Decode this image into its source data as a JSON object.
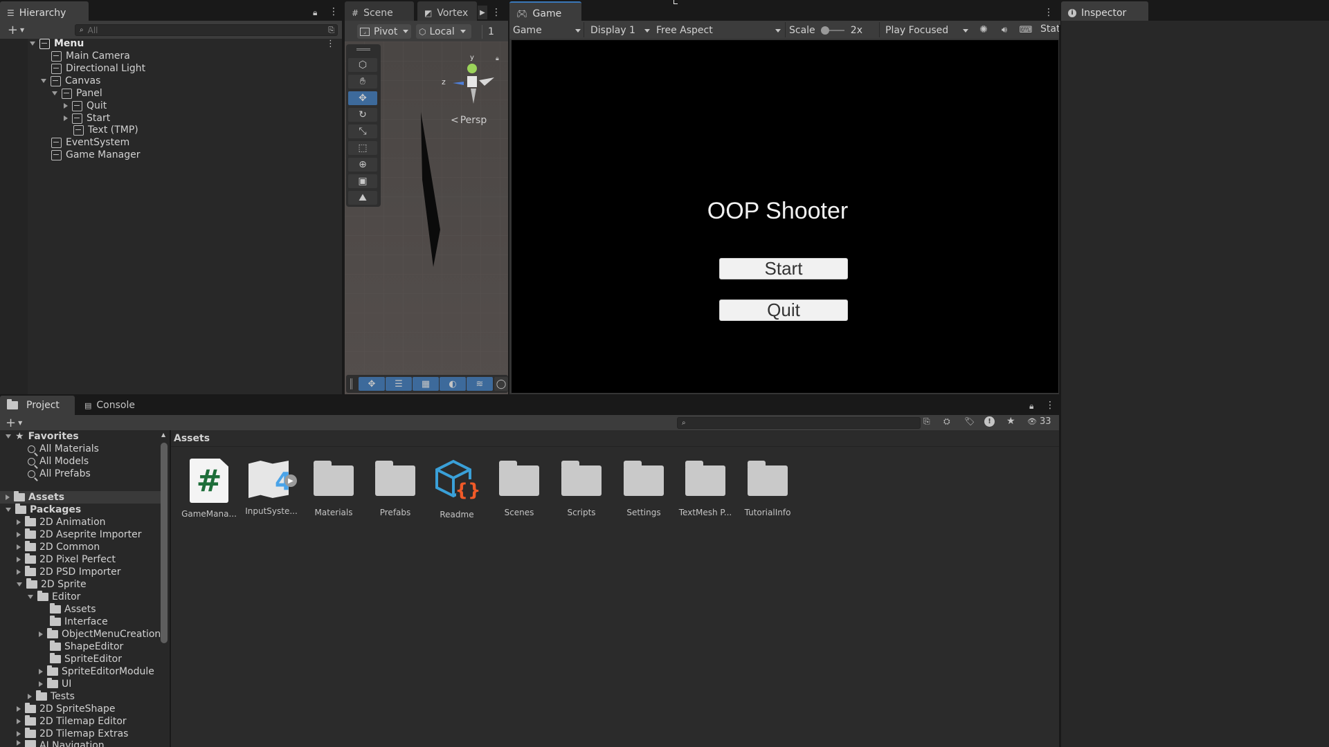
{
  "hierarchy": {
    "tab_label": "Hierarchy",
    "search_placeholder": "All",
    "items": [
      {
        "label": "Menu"
      },
      {
        "label": "Main Camera"
      },
      {
        "label": "Directional Light"
      },
      {
        "label": "Canvas"
      },
      {
        "label": "Panel"
      },
      {
        "label": "Quit"
      },
      {
        "label": "Start"
      },
      {
        "label": "Text (TMP)"
      },
      {
        "label": "EventSystem"
      },
      {
        "label": "Game Manager"
      }
    ]
  },
  "scene": {
    "tab_scene": "Scene",
    "tab_vortex": "Vortex",
    "pivot_label": "Pivot",
    "local_label": "Local",
    "snap_value": "1",
    "gizmo_y": "y",
    "gizmo_z": "z",
    "persp_label": "Persp"
  },
  "game": {
    "tab_label": "Game",
    "mode_label": "Game",
    "display_label": "Display 1",
    "aspect_label": "Free Aspect",
    "scale_label": "Scale",
    "scale_value": "2x",
    "play_focus_label": "Play Focused",
    "stats_label": "Stat",
    "view_title": "OOP Shooter",
    "start_button": "Start",
    "quit_button": "Quit"
  },
  "inspector": {
    "tab_label": "Inspector"
  },
  "project": {
    "tab_project": "Project",
    "tab_console": "Console",
    "hidden_count": "33",
    "breadcrumb": "Assets",
    "favorites_label": "Favorites",
    "favorites": [
      "All Materials",
      "All Models",
      "All Prefabs"
    ],
    "assets_label": "Assets",
    "packages_label": "Packages",
    "packages": [
      "2D Animation",
      "2D Aseprite Importer",
      "2D Common",
      "2D Pixel Perfect",
      "2D PSD Importer",
      "2D Sprite",
      "Editor",
      "Assets",
      "Interface",
      "ObjectMenuCreation",
      "ShapeEditor",
      "SpriteEditor",
      "SpriteEditorModule",
      "UI",
      "Tests",
      "2D SpriteShape",
      "2D Tilemap Editor",
      "2D Tilemap Extras",
      "AI Navigation"
    ],
    "assets": [
      {
        "label": "GameMana...",
        "icon": "csharp-script-icon"
      },
      {
        "label": "InputSyste...",
        "icon": "input-actions-icon"
      },
      {
        "label": "Materials",
        "icon": "folder-icon"
      },
      {
        "label": "Prefabs",
        "icon": "folder-icon"
      },
      {
        "label": "Readme",
        "icon": "readme-icon"
      },
      {
        "label": "Scenes",
        "icon": "folder-icon"
      },
      {
        "label": "Scripts",
        "icon": "folder-icon"
      },
      {
        "label": "Settings",
        "icon": "folder-icon"
      },
      {
        "label": "TextMesh P...",
        "icon": "folder-icon"
      },
      {
        "label": "TutorialInfo",
        "icon": "folder-icon"
      }
    ]
  },
  "colors": {
    "accent": "#3a79bb",
    "panel": "#282828",
    "toolbar": "#3c3c3c",
    "game_bg": "#000000"
  }
}
